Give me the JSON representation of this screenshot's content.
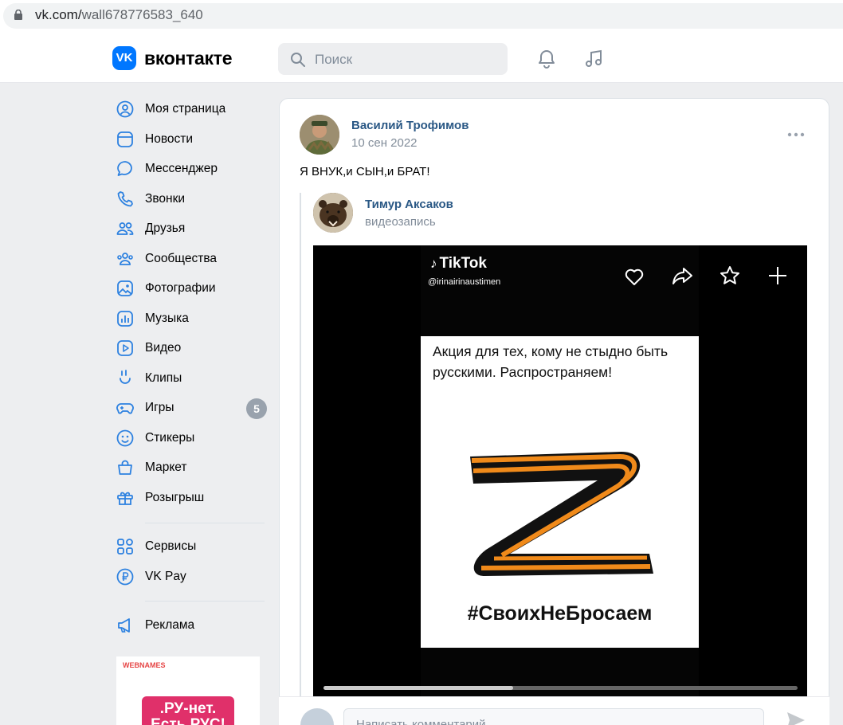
{
  "browser": {
    "url_domain": "vk.com/",
    "url_path": "wall678776583_640"
  },
  "header": {
    "logo_text": "VK",
    "brand": "вконтакте",
    "search_placeholder": "Поиск",
    "icons": [
      "bell-icon",
      "music-icon"
    ]
  },
  "sidebar": {
    "items": [
      {
        "label": "Моя страница",
        "icon": "user-circle-icon"
      },
      {
        "label": "Новости",
        "icon": "news-icon"
      },
      {
        "label": "Мессенджер",
        "icon": "message-icon"
      },
      {
        "label": "Звонки",
        "icon": "phone-icon"
      },
      {
        "label": "Друзья",
        "icon": "friends-icon"
      },
      {
        "label": "Сообщества",
        "icon": "communities-icon"
      },
      {
        "label": "Фотографии",
        "icon": "photo-icon"
      },
      {
        "label": "Музыка",
        "icon": "music-bars-icon"
      },
      {
        "label": "Видео",
        "icon": "video-icon"
      },
      {
        "label": "Клипы",
        "icon": "clips-icon"
      },
      {
        "label": "Игры",
        "icon": "gamepad-icon",
        "badge": "5"
      },
      {
        "label": "Стикеры",
        "icon": "sticker-icon"
      },
      {
        "label": "Маркет",
        "icon": "market-icon"
      },
      {
        "label": "Розыгрыш",
        "icon": "gift-icon"
      },
      {
        "label": "Сервисы",
        "icon": "services-icon"
      },
      {
        "label": "VK Pay",
        "icon": "ruble-icon"
      },
      {
        "label": "Реклама",
        "icon": "megaphone-icon"
      }
    ],
    "ad": {
      "logo": "WEBNAMES",
      "text": ".РУ-нет. Есть РУС!"
    }
  },
  "post": {
    "author": "Василий Трофимов",
    "date": "10 сен 2022",
    "text": "Я ВНУК,и СЫН,и БРАТ!",
    "repost": {
      "author": "Тимур Аксаков",
      "type": "видеозапись",
      "video": {
        "tiktok_label": "TikTok",
        "handle": "@irinairinaustimen",
        "caption": "Акция для тех, кому не стыдно быть русскими. Распространяем!",
        "hashtag": "#СвоихНеБросаем",
        "progress": 0.4,
        "icons": [
          "heart-icon",
          "share-icon",
          "star-icon",
          "plus-icon"
        ]
      }
    }
  },
  "comment": {
    "placeholder": "Написать комментарий..."
  },
  "colors": {
    "vk_blue": "#0077ff",
    "link": "#2a5885",
    "muted": "#818c99"
  }
}
